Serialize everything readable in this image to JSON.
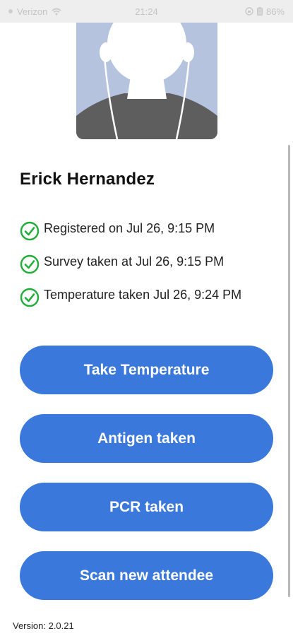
{
  "status_bar": {
    "carrier": "Verizon",
    "time": "21:24",
    "battery": "86%"
  },
  "profile": {
    "name": "Erick Hernandez"
  },
  "status_items": [
    {
      "icon": "check-circle-icon",
      "text": "Registered on Jul 26, 9:15 PM"
    },
    {
      "icon": "check-circle-icon",
      "text": "Survey taken at Jul 26, 9:15 PM"
    },
    {
      "icon": "check-circle-icon",
      "text": "Temperature taken Jul 26, 9:24 PM"
    }
  ],
  "actions": {
    "take_temperature": "Take Temperature",
    "antigen_taken": "Antigen taken",
    "pcr_taken": "PCR taken",
    "scan_new_attendee": "Scan new attendee"
  },
  "footer": {
    "version": "Version: 2.0.21"
  },
  "colors": {
    "primary_button": "#3b78dc",
    "check_green": "#1fae3a",
    "avatar_bg": "#b5c3df"
  }
}
